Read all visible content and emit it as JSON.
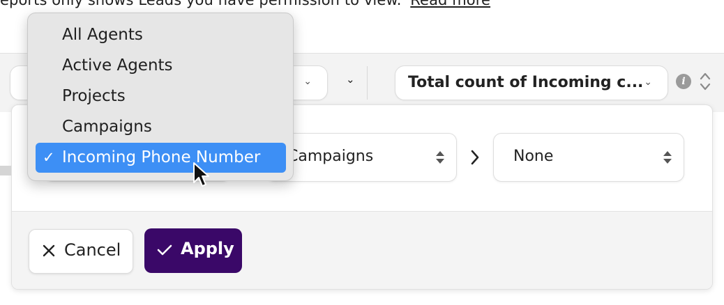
{
  "notice": {
    "text": "eports only shows Leads you have permission to view.",
    "link": "Read more"
  },
  "toolbar": {
    "metric_label": "Total count of Incoming c..."
  },
  "icons": {
    "info": "info-icon",
    "sort": "updown-icon",
    "chevron": "chevron-down-icon",
    "next": "chevron-right-icon",
    "cancel": "close-icon",
    "apply": "check-icon",
    "cursor": "cursor-icon"
  },
  "menu": {
    "items": [
      "All Agents",
      "Active Agents",
      "Projects",
      "Campaigns"
    ],
    "selected": "Incoming Phone Number"
  },
  "grouping": {
    "second": "Campaigns",
    "third": "None"
  },
  "actions": {
    "cancel": "Cancel",
    "apply": "Apply"
  },
  "colors": {
    "apply_bg": "#3a0868",
    "selected_bg": "#3d8ff5"
  }
}
